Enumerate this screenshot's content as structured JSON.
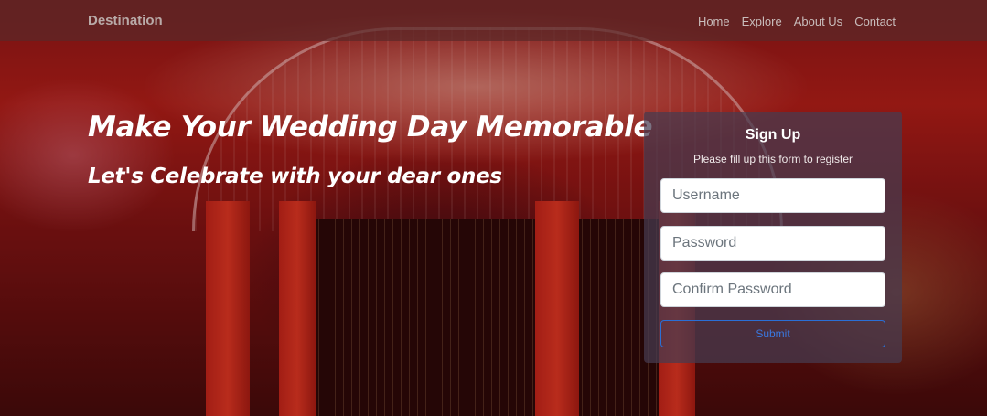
{
  "navbar": {
    "brand": "Destination",
    "links": [
      "Home",
      "Explore",
      "About Us",
      "Contact"
    ]
  },
  "hero": {
    "title": "Make Your Wedding Day Memorable",
    "subtitle": "Let's Celebrate with your dear ones"
  },
  "signup": {
    "title": "Sign Up",
    "description": "Please fill up this form to register",
    "username_placeholder": "Username",
    "password_placeholder": "Password",
    "confirm_placeholder": "Confirm Password",
    "submit_label": "Submit"
  }
}
